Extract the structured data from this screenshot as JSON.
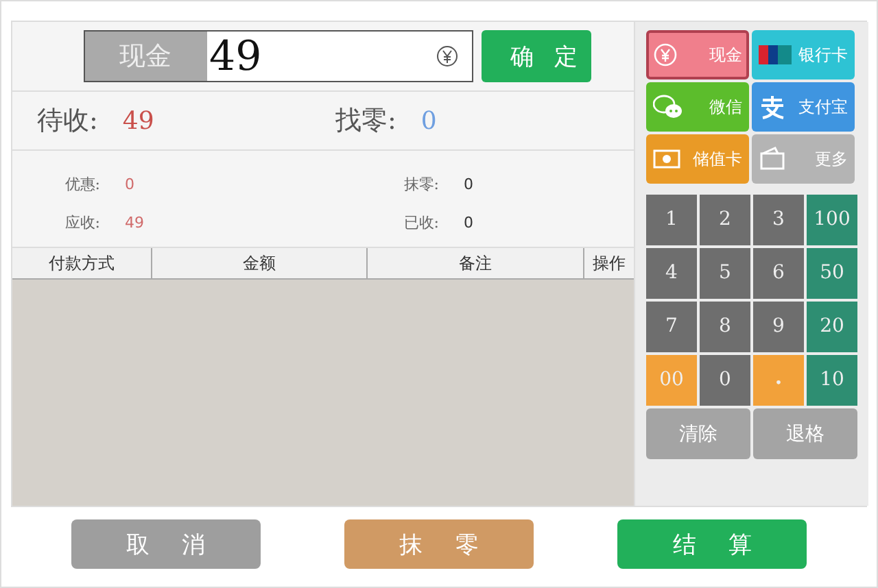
{
  "payment_input": {
    "method_label": "现金",
    "value": "49",
    "confirm": "确定"
  },
  "totals": [
    {
      "label": "待收:",
      "value": "49",
      "kind": "due"
    },
    {
      "label": "找零:",
      "value": "0",
      "kind": "change"
    }
  ],
  "details": [
    {
      "label": "优惠:",
      "value": "0",
      "kind": "red"
    },
    {
      "label": "抹零:",
      "value": "0",
      "kind": "plain"
    },
    {
      "label": "应收:",
      "value": "49",
      "kind": "red"
    },
    {
      "label": "已收:",
      "value": "0",
      "kind": "plain"
    }
  ],
  "table": {
    "columns": [
      "付款方式",
      "金额",
      "备注",
      "操作"
    ]
  },
  "methods": [
    {
      "label": "现金",
      "kind": "cash",
      "color": "#f07f8c",
      "selected": true
    },
    {
      "label": "银行卡",
      "kind": "bank",
      "color": "#2ec3d4",
      "selected": false
    },
    {
      "label": "微信",
      "kind": "wechat",
      "color": "#5cbd2c",
      "selected": false
    },
    {
      "label": "支付宝",
      "kind": "alipay",
      "color": "#3f95e0",
      "selected": false
    },
    {
      "label": "储值卡",
      "kind": "stored",
      "color": "#e99a26",
      "selected": false
    },
    {
      "label": "更多",
      "kind": "more",
      "color": "#b4b4b4",
      "selected": false
    }
  ],
  "keypad": [
    {
      "label": "1",
      "kind": "digit"
    },
    {
      "label": "2",
      "kind": "digit"
    },
    {
      "label": "3",
      "kind": "digit"
    },
    {
      "label": "100",
      "kind": "amount"
    },
    {
      "label": "4",
      "kind": "digit"
    },
    {
      "label": "5",
      "kind": "digit"
    },
    {
      "label": "6",
      "kind": "digit"
    },
    {
      "label": "50",
      "kind": "amount"
    },
    {
      "label": "7",
      "kind": "digit"
    },
    {
      "label": "8",
      "kind": "digit"
    },
    {
      "label": "9",
      "kind": "digit"
    },
    {
      "label": "20",
      "kind": "amount"
    },
    {
      "label": "00",
      "kind": "alt"
    },
    {
      "label": "0",
      "kind": "digit"
    },
    {
      "label": ".",
      "kind": "point"
    },
    {
      "label": "10",
      "kind": "amount"
    }
  ],
  "edit_keys": [
    "清除",
    "退格"
  ],
  "actions": [
    {
      "label": "取消",
      "kind": "cancel"
    },
    {
      "label": "抹零",
      "kind": "round"
    },
    {
      "label": "结算",
      "kind": "settle"
    }
  ]
}
